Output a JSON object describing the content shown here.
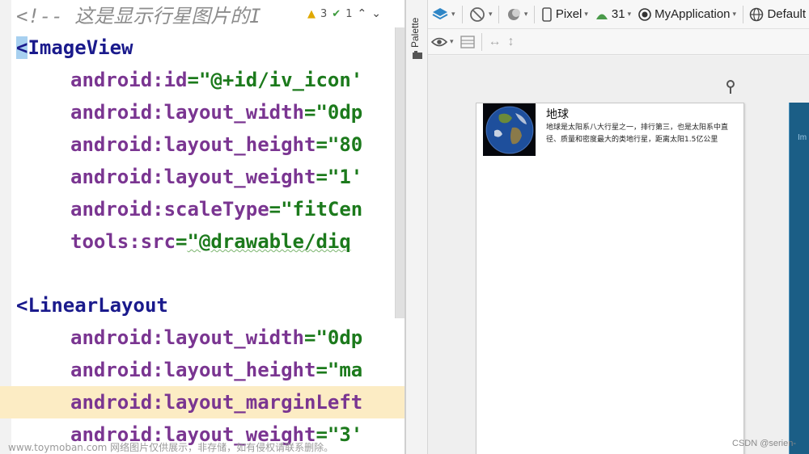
{
  "editor": {
    "lines": {
      "l0": {
        "comment": "<!-- 这是显示行星图片的I"
      },
      "l1": {
        "open": "<",
        "tag": "ImageView"
      },
      "l2": {
        "attr": "android:id",
        "eq": "=",
        "value": "\"@+id/iv_icon'"
      },
      "l3": {
        "attr": "android:layout_width",
        "eq": "=",
        "value": "\"0dp"
      },
      "l4": {
        "attr": "android:layout_height",
        "eq": "=",
        "value": "\"80"
      },
      "l5": {
        "attr": "android:layout_weight",
        "eq": "=",
        "value": "\"1'"
      },
      "l6": {
        "attr": "android:scaleType",
        "eq": "=",
        "value": "\"fitCen"
      },
      "l7": {
        "attr": "tools:src",
        "eq": "=",
        "value": "\"@drawable/diq"
      },
      "l8": {
        "open": "<",
        "tag": "LinearLayout"
      },
      "l9": {
        "attr": "android:layout_width",
        "eq": "=",
        "value": "\"0dp"
      },
      "l10": {
        "attr": "android:layout_height",
        "eq": "=",
        "value": "\"ma"
      },
      "l11": {
        "attr": "android:layout_marginLeft",
        "eq": "",
        "value": ""
      },
      "l12": {
        "attr": "android:layout_weight",
        "eq": "=",
        "value": "\"3'"
      }
    },
    "inspections": {
      "warnings": "3",
      "checks": "1"
    }
  },
  "palette": {
    "label": "Palette"
  },
  "designer": {
    "toolbar": {
      "device": "Pixel",
      "api": "31",
      "app": "MyApplication",
      "locale": "Default"
    },
    "preview": {
      "title": "地球",
      "description": "地球是太阳系八大行星之一，排行第三，也是太阳系中直径、质量和密度最大的类地行星，距离太阳1.5亿公里",
      "blueprint_text": "Im"
    }
  },
  "watermark": {
    "left": "www.toymoban.com 网络图片仅供展示，非存储，如有侵权请联系删除。",
    "right": "CSDN @serien-"
  },
  "colors": {
    "tag": "#1a1a8c",
    "attribute": "#7a3591",
    "value": "#1c7a1c",
    "comment": "#8c8c8c",
    "highlight_line": "#fcecc4",
    "blueprint": "#1b5e86"
  }
}
